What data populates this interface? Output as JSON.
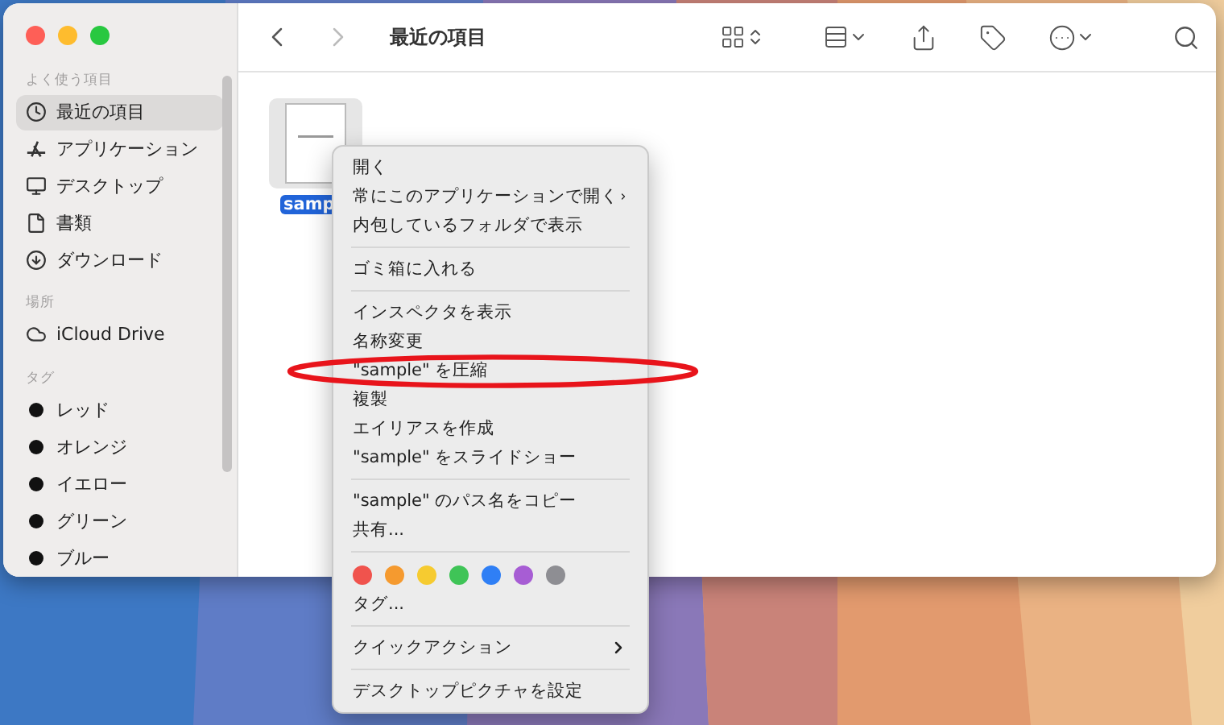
{
  "window": {
    "title": "最近の項目"
  },
  "sidebar": {
    "sections": [
      {
        "header": "よく使う項目",
        "items": [
          {
            "label": "最近の項目",
            "selected": true
          },
          {
            "label": "アプリケーション",
            "selected": false
          },
          {
            "label": "デスクトップ",
            "selected": false
          },
          {
            "label": "書類",
            "selected": false
          },
          {
            "label": "ダウンロード",
            "selected": false
          }
        ]
      },
      {
        "header": "場所",
        "items": [
          {
            "label": "iCloud Drive",
            "selected": false
          }
        ]
      },
      {
        "header": "タグ",
        "items": [
          {
            "label": "レッド",
            "selected": false
          },
          {
            "label": "オレンジ",
            "selected": false
          },
          {
            "label": "イエロー",
            "selected": false
          },
          {
            "label": "グリーン",
            "selected": false
          },
          {
            "label": "ブルー",
            "selected": false
          }
        ]
      }
    ]
  },
  "files": [
    {
      "name": "samp",
      "selected": true
    }
  ],
  "context_menu": {
    "items": [
      {
        "kind": "item",
        "label": "開く",
        "submenu": false
      },
      {
        "kind": "item",
        "label": "常にこのアプリケーションで開く",
        "submenu": true
      },
      {
        "kind": "item",
        "label": "内包しているフォルダで表示",
        "submenu": false
      },
      {
        "kind": "separator"
      },
      {
        "kind": "item",
        "label": "ゴミ箱に入れる",
        "submenu": false
      },
      {
        "kind": "separator"
      },
      {
        "kind": "item",
        "label": "インスペクタを表示",
        "submenu": false
      },
      {
        "kind": "item",
        "label": "名称変更",
        "submenu": false
      },
      {
        "kind": "item",
        "label": "\"sample\" を圧縮",
        "submenu": false
      },
      {
        "kind": "item",
        "label": "複製",
        "submenu": false
      },
      {
        "kind": "item",
        "label": "エイリアスを作成",
        "submenu": false
      },
      {
        "kind": "item",
        "label": "\"sample\" をスライドショー",
        "submenu": false
      },
      {
        "kind": "separator"
      },
      {
        "kind": "item",
        "label": "\"sample\" のパス名をコピー",
        "submenu": false
      },
      {
        "kind": "item",
        "label": "共有...",
        "submenu": false
      },
      {
        "kind": "separator"
      },
      {
        "kind": "tags",
        "dots": [
          {
            "color": "#f0534d"
          },
          {
            "color": "#f59a2f"
          },
          {
            "color": "#f6cb30"
          },
          {
            "color": "#3fc457"
          },
          {
            "color": "#2f7ff5"
          },
          {
            "color": "#a75dd4"
          },
          {
            "color": "#8e8e93"
          }
        ]
      },
      {
        "kind": "item",
        "label": "タグ...",
        "submenu": false
      },
      {
        "kind": "separator"
      },
      {
        "kind": "item",
        "label": "クイックアクション",
        "submenu": true
      },
      {
        "kind": "separator"
      },
      {
        "kind": "item",
        "label": "デスクトップピクチャを設定",
        "submenu": false
      }
    ]
  }
}
